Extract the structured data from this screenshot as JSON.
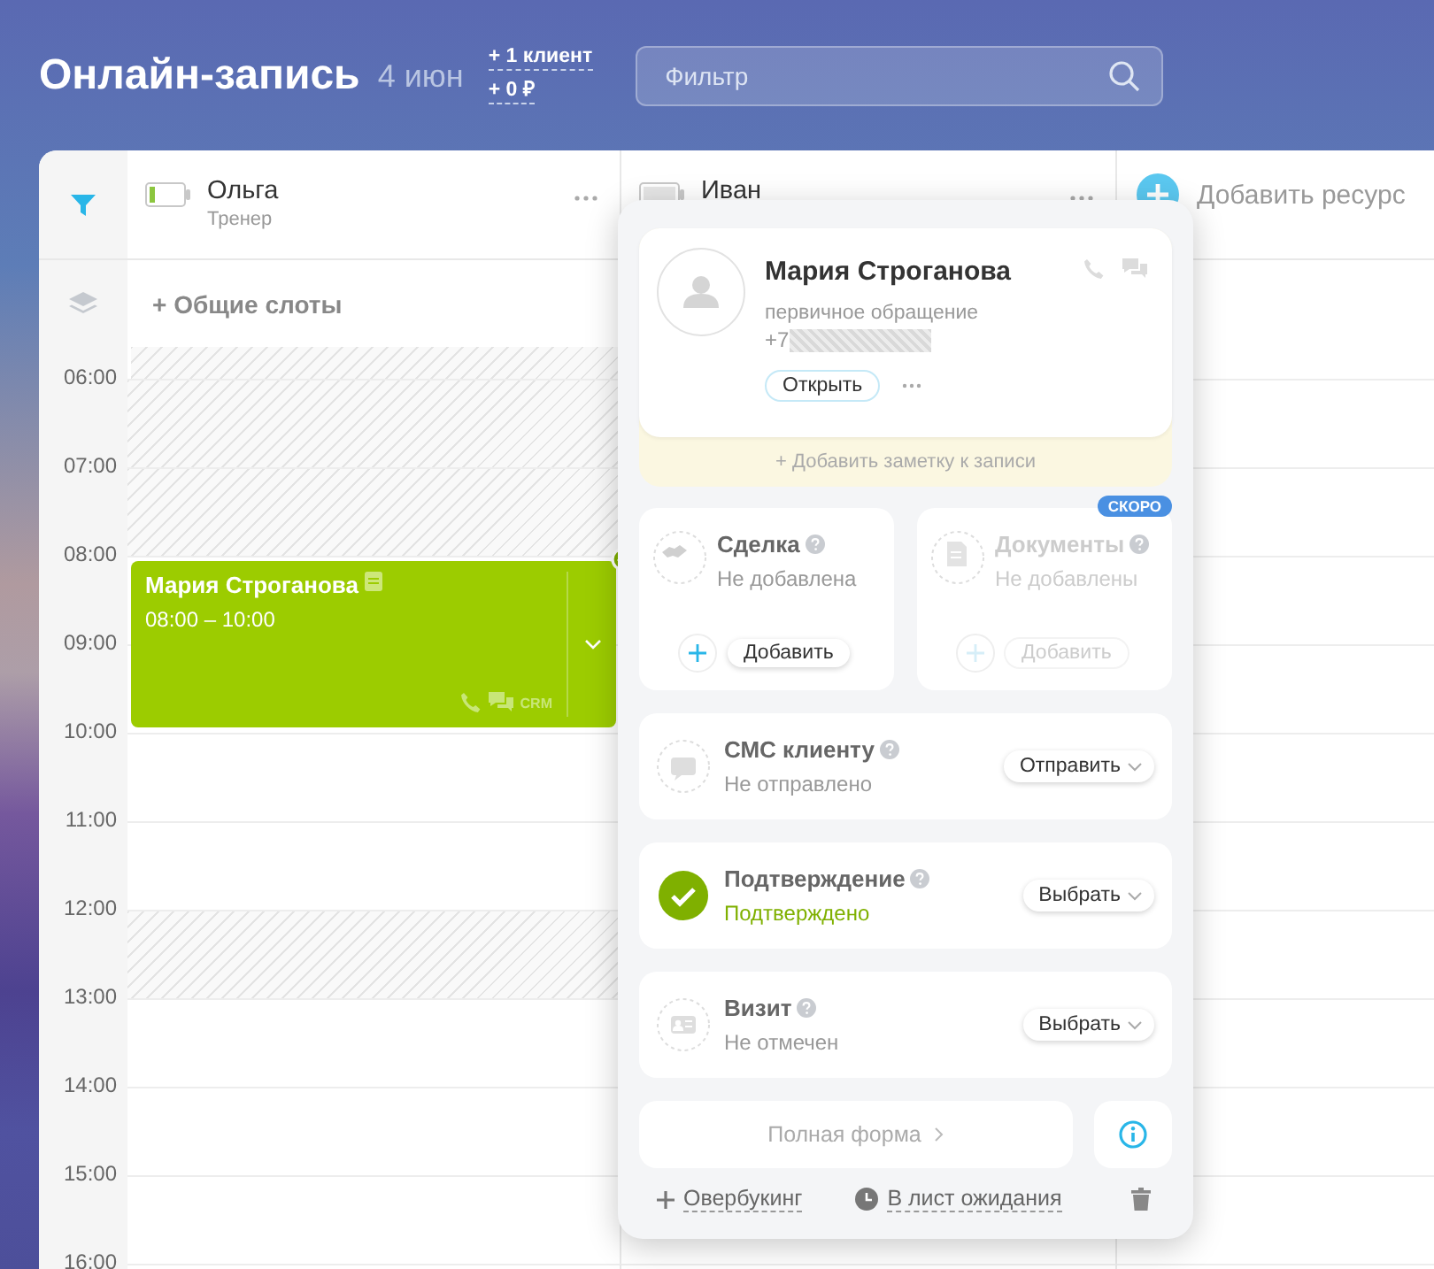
{
  "header": {
    "title": "Онлайн-запись",
    "date": "4 июн",
    "stats": [
      "+ 1 клиент",
      "+ 0 ₽"
    ],
    "filter": {
      "placeholder": "Фильтр"
    }
  },
  "resources": [
    {
      "name": "Ольга",
      "role": "Тренер",
      "active": true
    },
    {
      "name": "Иван",
      "active": false
    }
  ],
  "add_resource": "Добавить ресурс",
  "common_slots": "+ Общие слоты",
  "slots": [
    {
      "time": "06:00",
      "blocked": true
    },
    {
      "time": "07:00",
      "blocked": true
    },
    {
      "time": "08:00",
      "blocked": false,
      "event": {
        "client": "Мария Строганова",
        "time": "08:00 – 10:00",
        "crm": "CRM",
        "confirmed": true
      }
    },
    {
      "time": "09:00",
      "blocked": false
    },
    {
      "time": "10:00",
      "blocked": false
    },
    {
      "time": "11:00",
      "blocked": false
    },
    {
      "time": "12:00",
      "blocked": true
    },
    {
      "time": "13:00",
      "blocked": false
    },
    {
      "time": "14:00",
      "blocked": false
    },
    {
      "time": "15:00",
      "blocked": false
    },
    {
      "time": "16:00",
      "blocked": false
    }
  ],
  "popup": {
    "client": {
      "name": "Мария Строганова",
      "source": "первичное обращение",
      "phone": "+7",
      "open_button": "Открыть"
    },
    "note": "+ Добавить заметку к записи",
    "tiles": [
      {
        "kind": "deal",
        "title": "Сделка",
        "status": "Не добавлена",
        "button": "Добавить",
        "disabled": false
      },
      {
        "kind": "documents",
        "title": "Документы",
        "status": "Не добавлены",
        "button": "Добавить",
        "disabled": true,
        "badge": "СКОРО"
      }
    ],
    "rows": [
      {
        "kind": "sms",
        "title": "СМС клиенту",
        "status": "Не отправлено",
        "button": "Отправить",
        "done": false
      },
      {
        "kind": "confirm",
        "title": "Подтверждение",
        "status": "Подтверждено",
        "button": "Выбрать",
        "done": true
      },
      {
        "kind": "visit",
        "title": "Визит",
        "status": "Не отмечен",
        "button": "Выбрать",
        "done": false
      }
    ],
    "full_form": "Полная форма",
    "actions": [
      {
        "kind": "overbooking",
        "label": "Овербукинг"
      },
      {
        "kind": "waitlist",
        "label": "В лист ожидания"
      }
    ]
  }
}
